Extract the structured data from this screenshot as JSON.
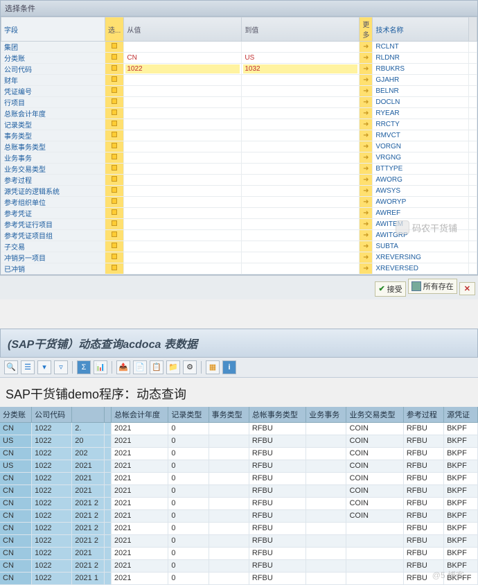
{
  "top": {
    "title": "选择条件",
    "headers": {
      "field": "字段",
      "sel": "选...",
      "from": "从值",
      "to": "到值",
      "more": "更多",
      "tech": "技术名称"
    },
    "rows": [
      {
        "label": "集团",
        "from": "",
        "to": "",
        "tech": "RCLNT",
        "red": false
      },
      {
        "label": "分类账",
        "from": "CN",
        "to": "US",
        "tech": "RLDNR",
        "red": true
      },
      {
        "label": "公司代码",
        "from": "1022",
        "to": "1032",
        "tech": "RBUKRS",
        "red": true,
        "hl": true
      },
      {
        "label": "财年",
        "from": "",
        "to": "",
        "tech": "GJAHR",
        "red": false
      },
      {
        "label": "凭证编号",
        "from": "",
        "to": "",
        "tech": "BELNR",
        "red": false
      },
      {
        "label": "行项目",
        "from": "",
        "to": "",
        "tech": "DOCLN",
        "red": false
      },
      {
        "label": "总账会计年度",
        "from": "",
        "to": "",
        "tech": "RYEAR",
        "red": false
      },
      {
        "label": "记录类型",
        "from": "",
        "to": "",
        "tech": "RRCTY",
        "red": false
      },
      {
        "label": "事务类型",
        "from": "",
        "to": "",
        "tech": "RMVCT",
        "red": false
      },
      {
        "label": "总账事务类型",
        "from": "",
        "to": "",
        "tech": "VORGN",
        "red": false
      },
      {
        "label": "业务事务",
        "from": "",
        "to": "",
        "tech": "VRGNG",
        "red": false
      },
      {
        "label": "业务交易类型",
        "from": "",
        "to": "",
        "tech": "BTTYPE",
        "red": false
      },
      {
        "label": "参考过程",
        "from": "",
        "to": "",
        "tech": "AWORG",
        "red": false
      },
      {
        "label": "源凭证的逻辑系统",
        "from": "",
        "to": "",
        "tech": "AWSYS",
        "red": false
      },
      {
        "label": "参考组织单位",
        "from": "",
        "to": "",
        "tech": "AWORYP",
        "red": false
      },
      {
        "label": "参考凭证",
        "from": "",
        "to": "",
        "tech": "AWREF",
        "red": false
      },
      {
        "label": "参考凭证行项目",
        "from": "",
        "to": "",
        "tech": "AWITEM",
        "red": false
      },
      {
        "label": "参考凭证项目组",
        "from": "",
        "to": "",
        "tech": "AWITGRP",
        "red": false
      },
      {
        "label": "子交易",
        "from": "",
        "to": "",
        "tech": "SUBTA",
        "red": false
      },
      {
        "label": "冲销另一项目",
        "from": "",
        "to": "",
        "tech": "XREVERSING",
        "red": false
      },
      {
        "label": "已冲销",
        "from": "",
        "to": "",
        "tech": "XREVERSED",
        "red": false
      }
    ]
  },
  "midbar": {
    "accept": "接受",
    "all_none": "所有存在"
  },
  "watermark1": "码农干货铺",
  "watermark2": "@5   博客",
  "report": {
    "title": "(SAP干货铺）动态查询acdoca 表数据",
    "demo_title": "SAP干货铺demo程序：动态查询",
    "toolbar_icons": [
      "find",
      "hier",
      "filter",
      "funnel",
      "sum",
      "chart",
      "export",
      "excel",
      "word",
      "mail",
      "fx",
      "grid",
      "info"
    ],
    "headers": [
      "分类账",
      "公司代码",
      "",
      "",
      "总帐会计年度",
      "记录类型",
      "事务类型",
      "总帐事务类型",
      "业务事务",
      "业务交易类型",
      "参考过程",
      "源凭证"
    ],
    "rows": [
      [
        "CN",
        "1022",
        "2.",
        "",
        "2021",
        "0",
        "",
        "RFBU",
        "",
        "COIN",
        "RFBU",
        "BKPF"
      ],
      [
        "US",
        "1022",
        "20",
        "",
        "2021",
        "0",
        "",
        "RFBU",
        "",
        "COIN",
        "RFBU",
        "BKPF"
      ],
      [
        "CN",
        "1022",
        "202",
        "",
        "2021",
        "0",
        "",
        "RFBU",
        "",
        "COIN",
        "RFBU",
        "BKPF"
      ],
      [
        "US",
        "1022",
        "2021",
        "",
        "2021",
        "0",
        "",
        "RFBU",
        "",
        "COIN",
        "RFBU",
        "BKPF"
      ],
      [
        "CN",
        "1022",
        "2021",
        "",
        "2021",
        "0",
        "",
        "RFBU",
        "",
        "COIN",
        "RFBU",
        "BKPF"
      ],
      [
        "CN",
        "1022",
        "2021",
        "",
        "2021",
        "0",
        "",
        "RFBU",
        "",
        "COIN",
        "RFBU",
        "BKPF"
      ],
      [
        "CN",
        "1022",
        "2021 2",
        "",
        "2021",
        "0",
        "",
        "RFBU",
        "",
        "COIN",
        "RFBU",
        "BKPF"
      ],
      [
        "CN",
        "1022",
        "2021 2",
        "",
        "2021",
        "0",
        "",
        "RFBU",
        "",
        "COIN",
        "RFBU",
        "BKPF"
      ],
      [
        "CN",
        "1022",
        "2021 2",
        "",
        "2021",
        "0",
        "",
        "RFBU",
        "",
        "",
        "RFBU",
        "BKPF"
      ],
      [
        "CN",
        "1022",
        "2021 2",
        "",
        "2021",
        "0",
        "",
        "RFBU",
        "",
        "",
        "RFBU",
        "BKPF"
      ],
      [
        "CN",
        "1022",
        "2021",
        "",
        "2021",
        "0",
        "",
        "RFBU",
        "",
        "",
        "RFBU",
        "BKPF"
      ],
      [
        "CN",
        "1022",
        "2021 2",
        "",
        "2021",
        "0",
        "",
        "RFBU",
        "",
        "",
        "RFBU",
        "BKPF"
      ],
      [
        "CN",
        "1022",
        "2021 1",
        "",
        "2021",
        "0",
        "",
        "RFBU",
        "",
        "",
        "RFBU",
        "BKPFF"
      ]
    ]
  }
}
